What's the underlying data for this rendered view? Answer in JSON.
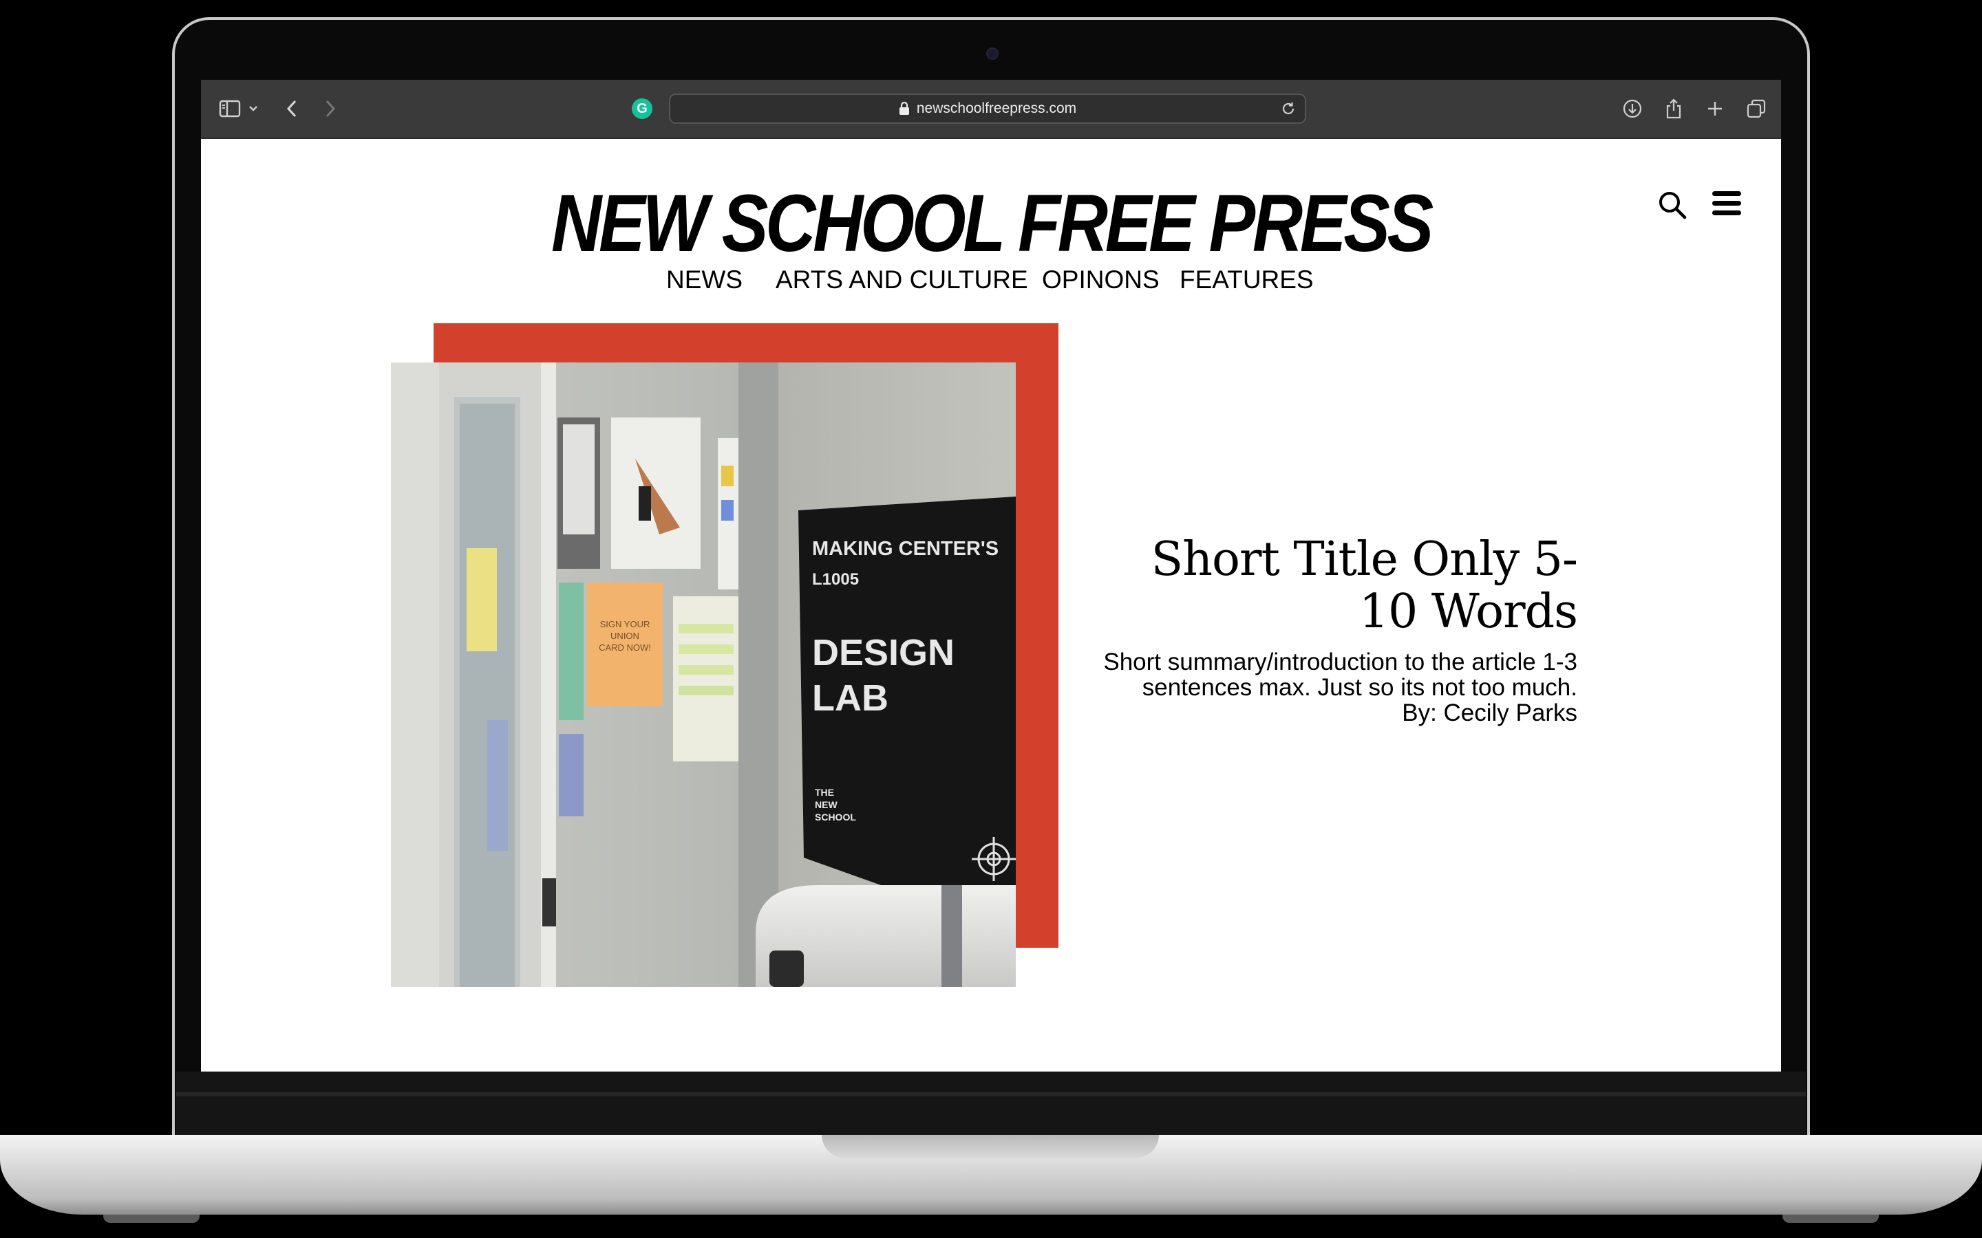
{
  "browser": {
    "url": "newschoolfreepress.com"
  },
  "site": {
    "masthead": "NEW SCHOOL FREE PRESS",
    "nav": [
      {
        "label": "NEWS"
      },
      {
        "label": "ARTS AND CULTURE"
      },
      {
        "label": "OPINONS"
      },
      {
        "label": "FEATURES"
      }
    ]
  },
  "photo": {
    "sign_line1": "MAKING CENTER'S",
    "sign_line2": "L1005",
    "sign_line3": "DESIGN",
    "sign_line4": "LAB",
    "sign_logo1": "THE",
    "sign_logo2": "NEW",
    "sign_logo3": "SCHOOL",
    "poster_text1": "SIGN YOUR",
    "poster_text2": "UNION",
    "poster_text3": "CARD NOW!"
  },
  "article": {
    "title": "Short Title Only 5-10 Words",
    "summary": "Short summary/introduction to the article 1-3 sentences max. Just so its not too much.",
    "byline": "By: Cecily Parks"
  },
  "colors": {
    "accent_red": "#d3402c",
    "toolbar_bg": "#3a3a3a",
    "grammarly_green": "#15c39a"
  }
}
